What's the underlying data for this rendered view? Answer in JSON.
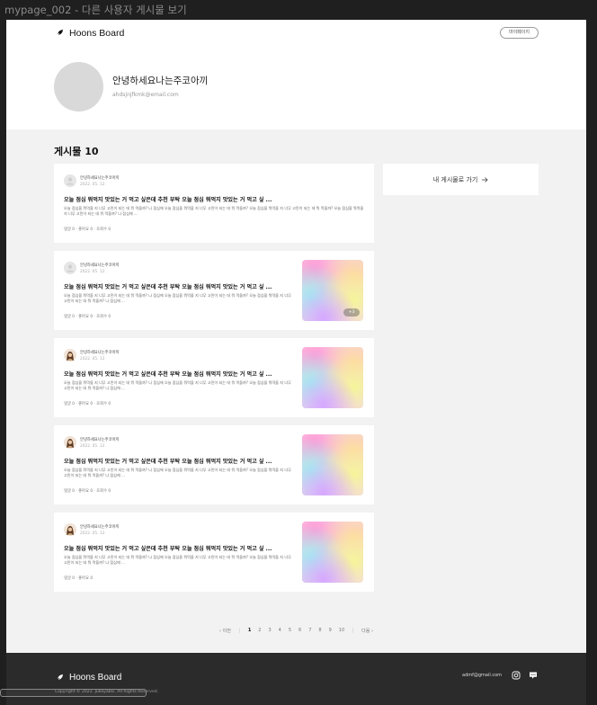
{
  "frame": {
    "title": "mypage_002 - 다른 사용자 게시물 보기"
  },
  "header": {
    "logo_text": "Hoons Board",
    "mypage_label": "마이페이지"
  },
  "profile": {
    "name": "안녕하세요나는주코아끼",
    "email": "ahdsjnjfkmk@email.com"
  },
  "section": {
    "title": "게시물 10"
  },
  "goto_button": {
    "label": "내 게시물로 가기"
  },
  "posts": [
    {
      "author": "안녕하세요나는주코아끼",
      "date": "2022. 05. 12.",
      "title": "오늘 점심 뭐먹지 맛있는 거 먹고 싶은데 추천 부탁 오늘 점심 뭐먹지 맛있는 거 먹고 싶 ...",
      "excerpt": "오늘 점심을 뭐먹을 지 너무 고민이 되는 데 뭐 먹을까? 나 점심에 오늘 점심을 뭐먹을 지 너무 고민이 되는 데 뭐 먹을까? 오늘 점심을 뭐먹을 지 너무 고민이 되는 데 뭐 먹을까? 오늘 점심을 뭐먹을 지 너무 고민이 되는 데 뭐 먹을까? 나 점심에 ...",
      "stats": "댓글 0 · 좋아요 0 · 조회수 0",
      "has_image": false,
      "avatar": "default",
      "image_badge": ""
    },
    {
      "author": "안녕하세요나는주코아끼",
      "date": "2022. 05. 12.",
      "title": "오늘 점심 뭐먹지 맛있는 거 먹고 싶은데 추천 부탁 오늘 점심 뭐먹지 맛있는 거 먹고 싶 ...",
      "excerpt": "오늘 점심을 뭐먹을 지 너무 고민이 되는 데 뭐 먹을까? 나 점심에 오늘 점심을 뭐먹을 지 너무 고민이 되는 데 뭐 먹을까? 오늘 점심을 뭐먹을 지 너무 고민이 되는 데 뭐 먹을까? 나 점심에 ...",
      "stats": "댓글 0 · 좋아요 0 · 조회수 0",
      "has_image": true,
      "avatar": "default",
      "image_badge": "+3"
    },
    {
      "author": "안녕하세요나는주코아끼",
      "date": "2022. 05. 12.",
      "title": "오늘 점심 뭐먹지 맛있는 거 먹고 싶은데 추천 부탁 오늘 점심 뭐먹지 맛있는 거 먹고 싶 ...",
      "excerpt": "오늘 점심을 뭐먹을 지 너무 고민이 되는 데 뭐 먹을까? 나 점심에 오늘 점심을 뭐먹을 지 너무 고민이 되는 데 뭐 먹을까? 오늘 점심을 뭐먹을 지 너무 고민이 되는 데 뭐 먹을까? 나 점심에 ...",
      "stats": "댓글 0 · 좋아요 0 · 조회수 0",
      "has_image": true,
      "avatar": "photo",
      "image_badge": ""
    },
    {
      "author": "안녕하세요나는주코아끼",
      "date": "2022. 05. 12.",
      "title": "오늘 점심 뭐먹지 맛있는 거 먹고 싶은데 추천 부탁 오늘 점심 뭐먹지 맛있는 거 먹고 싶 ...",
      "excerpt": "오늘 점심을 뭐먹을 지 너무 고민이 되는 데 뭐 먹을까? 나 점심에 오늘 점심을 뭐먹을 지 너무 고민이 되는 데 뭐 먹을까? 오늘 점심을 뭐먹을 지 너무 고민이 되는 데 뭐 먹을까? 나 점심에 ...",
      "stats": "댓글 0 · 좋아요 0 · 조회수 0",
      "has_image": true,
      "avatar": "photo",
      "image_badge": ""
    },
    {
      "author": "안녕하세요나는주코아끼",
      "date": "2022. 05. 12.",
      "title": "오늘 점심 뭐먹지 맛있는 거 먹고 싶은데 추천 부탁 오늘 점심 뭐먹지 맛있는 거 먹고 싶 ...",
      "excerpt": "오늘 점심을 뭐먹을 지 너무 고민이 되는 데 뭐 먹을까? 나 점심에 오늘 점심을 뭐먹을 지 너무 고민이 되는 데 뭐 먹을까? 오늘 점심을 뭐먹을 지 너무 고민이 되는 데 뭐 먹을까? 나 점심에 ...",
      "stats": "댓글 0 · 좋아요 0",
      "has_image": true,
      "avatar": "photo",
      "image_badge": ""
    }
  ],
  "pagination": {
    "prev": "‹ 이전",
    "next": "다음 ›",
    "pages": [
      "1",
      "2",
      "3",
      "4",
      "5",
      "6",
      "7",
      "8",
      "9",
      "10"
    ],
    "current": "1"
  },
  "footer": {
    "logo_text": "Hoons Board",
    "copyright": "Copyright © 2022. Jukoyakki. All Rights Reserved.",
    "email": "admf@gmail.com"
  },
  "icons": {
    "logo": "feather-icon",
    "arrow": "arrow-right-icon",
    "instagram": "instagram-icon",
    "chat": "chat-bubble-icon"
  }
}
